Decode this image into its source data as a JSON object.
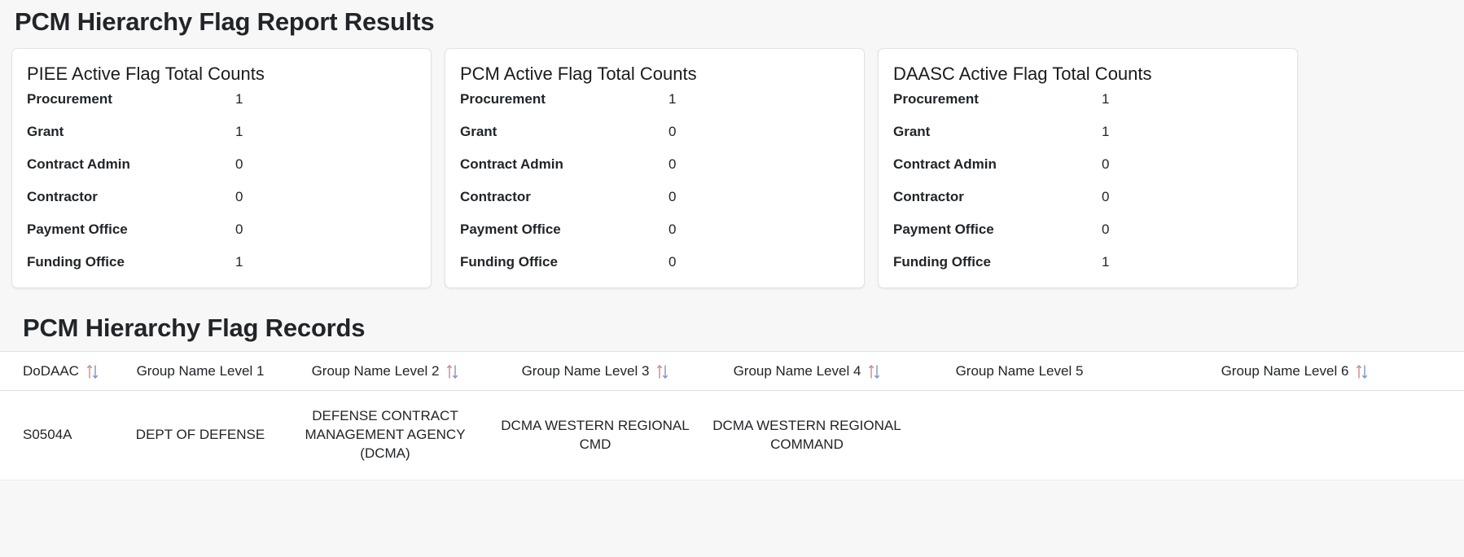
{
  "page": {
    "title": "PCM Hierarchy Flag Report Results"
  },
  "summary_cards": [
    {
      "title": "PIEE Active Flag Total Counts",
      "rows": [
        {
          "label": "Procurement",
          "value": "1"
        },
        {
          "label": "Grant",
          "value": "1"
        },
        {
          "label": "Contract Admin",
          "value": "0"
        },
        {
          "label": "Contractor",
          "value": "0"
        },
        {
          "label": "Payment Office",
          "value": "0"
        },
        {
          "label": "Funding Office",
          "value": "1"
        }
      ]
    },
    {
      "title": "PCM Active Flag Total Counts",
      "rows": [
        {
          "label": "Procurement",
          "value": "1"
        },
        {
          "label": "Grant",
          "value": "0"
        },
        {
          "label": "Contract Admin",
          "value": "0"
        },
        {
          "label": "Contractor",
          "value": "0"
        },
        {
          "label": "Payment Office",
          "value": "0"
        },
        {
          "label": "Funding Office",
          "value": "0"
        }
      ]
    },
    {
      "title": "DAASC Active Flag Total Counts",
      "rows": [
        {
          "label": "Procurement",
          "value": "1"
        },
        {
          "label": "Grant",
          "value": "1"
        },
        {
          "label": "Contract Admin",
          "value": "0"
        },
        {
          "label": "Contractor",
          "value": "0"
        },
        {
          "label": "Payment Office",
          "value": "0"
        },
        {
          "label": "Funding Office",
          "value": "1"
        }
      ]
    }
  ],
  "records": {
    "title": "PCM Hierarchy Flag Records",
    "columns": [
      {
        "label": "DoDAAC",
        "sortable": true,
        "sort_icon": "sort-updown-icon"
      },
      {
        "label": "Group Name Level 1",
        "sortable": false,
        "sort_icon": ""
      },
      {
        "label": "Group Name Level 2",
        "sortable": true,
        "sort_icon": "sort-updown-icon"
      },
      {
        "label": "Group Name Level 3",
        "sortable": true,
        "sort_icon": "sort-updown-icon"
      },
      {
        "label": "Group Name Level 4",
        "sortable": true,
        "sort_icon": "sort-updown-icon"
      },
      {
        "label": "Group Name Level 5",
        "sortable": false,
        "sort_icon": ""
      },
      {
        "label": "Group Name Level 6",
        "sortable": true,
        "sort_icon": "sort-updown-icon"
      }
    ],
    "rows": [
      {
        "cells": [
          "S0504A",
          "DEPT OF DEFENSE",
          "DEFENSE CONTRACT MANAGEMENT AGENCY (DCMA)",
          "DCMA WESTERN REGIONAL CMD",
          "DCMA WESTERN REGIONAL COMMAND",
          "",
          ""
        ]
      }
    ]
  },
  "colors": {
    "page_background": "#f7f7f8",
    "card_background": "#ffffff",
    "card_border": "#e3e3e5",
    "text": "#212529",
    "sort_arrow_up": "#c98b86",
    "sort_arrow_down": "#7f93c4"
  }
}
